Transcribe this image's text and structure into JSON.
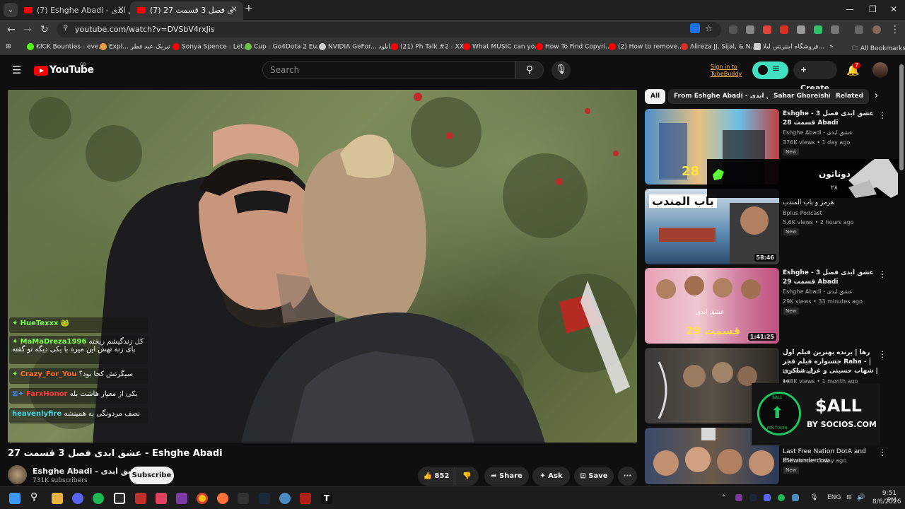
{
  "browser": {
    "tabs": [
      {
        "title": "(7) Eshghe Abadi - عشق ابدی - Y",
        "active": false
      },
      {
        "title": "(7) عشق ابدی فصل 3 قسمت 27 -",
        "active": true
      }
    ],
    "url": "youtube.com/watch?v=DVSbV4rxJis",
    "bookmarks": [
      "KICK Bounties - eve...",
      "Expl... تبریک عید فطر",
      "Sonya Spence - Let...",
      "Cup - Go4Dota 2 Eu...",
      "NVIDIA GeFor... دانلود",
      "(21) Ph Talk #2 - XX...",
      "What MUSIC can yo...",
      "How To Find Copyri...",
      "(2) How to remove...",
      "Alireza JJ, Sijal, & N...",
      "فروشگاه اینترنتی لیلا..."
    ],
    "all_bookmarks": "All Bookmarks",
    "more_bookmarks": "»"
  },
  "youtube": {
    "logo_text": "YouTube",
    "logo_country": "GB",
    "search_placeholder": "Search",
    "tubebuddy_line1": "Sign in to",
    "tubebuddy_line2": "TubeBuddy",
    "create_label": "Create",
    "notif_count": "7"
  },
  "video": {
    "title": "عشق ابدی فصل 3 قسمت 27 - Eshghe Abadi",
    "channel_name": "Eshghe Abadi - عشق ابدی",
    "subscribers": "731K subscribers",
    "subscribe_label": "Subscribe",
    "likes": "852",
    "share_label": "Share",
    "ask_label": "Ask",
    "save_label": "Save",
    "more_label": "···"
  },
  "chat": [
    {
      "name": "HueTexxx",
      "message": "",
      "name_color": "#7cff4d"
    },
    {
      "name": "MaMaDreza1996",
      "message": "کل زندگیشم ریخته پای زنه تهش این میره با یکی دیگه تو گفته",
      "name_color": "#7cff4d"
    },
    {
      "name": "Crazy_For_You",
      "message": "سیگرتش کجا بود؟",
      "name_color": "#ff6a2a"
    },
    {
      "name": "FarxHonor",
      "message": "یکی از معیار هاشت بله",
      "name_color": "#ff3a3a"
    },
    {
      "name": "heavenlyfire",
      "message": "نصف مردونگی به همینشه",
      "name_color": "#4ad3e0"
    }
  ],
  "sidebar": {
    "chips": [
      "All",
      "From Eshghe Abadi - عشق ابدی",
      "Sahar Ghoreishi",
      "Related"
    ],
    "cards": [
      {
        "title": "Eshghe - عشق ابدی فصل 3 قسمت 28 Abadi",
        "channel": "Eshghe Abadi - عشق ابدی",
        "meta": "376K views • 1 day ago",
        "badge": "New",
        "duration": ""
      },
      {
        "title": "هرمز و باب المندب",
        "channel": "Bplus Podcast",
        "meta": "5.6K views • 2 hours ago",
        "badge": "New",
        "duration": "58:46"
      },
      {
        "title": "Eshghe - عشق ابدی فصل 3 قسمت 29 Abadi",
        "channel": "Eshghe Abadi - عشق ابدی",
        "meta": "29K views • 33 minutes ago",
        "badge": "New",
        "duration": "1:41:25"
      },
      {
        "title": "رها | برنده بهترین فیلم اول جشنواره فیلم فجر Raha - | شهاب حسینی و غزل شاکری | ...",
        "channel": "Honar Aval",
        "meta": "168K views • 1 month ago",
        "badge": "",
        "duration": ""
      },
      {
        "title": "Last Free Nation DotA and thewondercow",
        "channel": "",
        "meta": "25K views • 1 day ago",
        "badge": "New",
        "duration": ""
      }
    ],
    "thumb_texts": {
      "card1": "28",
      "card2": "باب المندب",
      "card3": "قسمت 29",
      "card3_top": "عشق ابدی"
    }
  },
  "overlays": {
    "donatoon_name": "دوناتون",
    "donatoon_sub": "۲۸",
    "sall_text": "$ALL",
    "sall_sub": "BY SOCIOS.COM",
    "sall_badge_top": "$ALL",
    "sall_badge_bottom": "FAN TOKEN"
  },
  "taskbar": {
    "lang": "ENG",
    "time": "9:51 PM",
    "date": "8/6/2026"
  },
  "colors": {
    "accent": "#ff0000",
    "background": "#0f0f0f",
    "tubebuddy": "#40e0c0"
  }
}
